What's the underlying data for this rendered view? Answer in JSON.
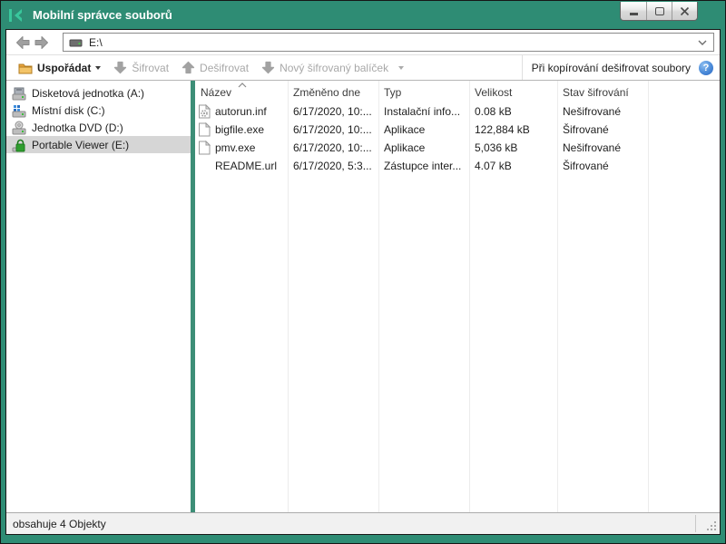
{
  "window": {
    "title": "Mobilní správce souborů"
  },
  "addressbar": {
    "path": "E:\\"
  },
  "toolbar": {
    "organize": "Uspořádat",
    "encrypt": "Šifrovat",
    "decrypt": "Dešifrovat",
    "new_package": "Nový šifrovaný balíček",
    "copy_decrypt_label": "Při kopírování dešifrovat soubory"
  },
  "icons": {
    "help": "?"
  },
  "sidebar": {
    "items": [
      {
        "label": "Disketová jednotka (A:)",
        "icon": "floppy-drive-icon",
        "selected": false
      },
      {
        "label": "Místní disk (C:)",
        "icon": "local-disk-icon",
        "selected": false
      },
      {
        "label": "Jednotka DVD (D:)",
        "icon": "dvd-drive-icon",
        "selected": false
      },
      {
        "label": "Portable Viewer (E:)",
        "icon": "encrypted-drive-icon",
        "selected": true
      }
    ]
  },
  "filelist": {
    "columns": [
      "Název",
      "Změněno dne",
      "Typ",
      "Velikost",
      "Stav šifrování"
    ],
    "sort": {
      "column": "Název",
      "direction": "asc"
    },
    "rows": [
      {
        "icon": "autorun-file-icon",
        "name": "autorun.inf",
        "modified": "6/17/2020, 10:...",
        "type": "Instalační info...",
        "size": "0.08 kB",
        "status": "Nešifrované"
      },
      {
        "icon": "file-icon",
        "name": "bigfile.exe",
        "modified": "6/17/2020, 10:...",
        "type": "Aplikace",
        "size": "122,884 kB",
        "status": "Šifrované"
      },
      {
        "icon": "file-icon",
        "name": "pmv.exe",
        "modified": "6/17/2020, 10:...",
        "type": "Aplikace",
        "size": "5,036 kB",
        "status": "Nešifrované"
      },
      {
        "icon": "none",
        "name": "README.url",
        "modified": "6/17/2020, 5:3...",
        "type": "Zástupce inter...",
        "size": "4.07 kB",
        "status": "Šifrované"
      }
    ]
  },
  "statusbar": {
    "text": "obsahuje 4 Objekty"
  },
  "colors": {
    "titlebar": "#2E8C74",
    "logo": "#39C79C",
    "splitter": "#3D8E77",
    "selected_row": "#D6D6D6",
    "disabled_text": "#A8A8A8",
    "help_icon": "#3B7FD0",
    "lock_green": "#2F9E2F",
    "folder_yellow": "#E8A33D"
  }
}
